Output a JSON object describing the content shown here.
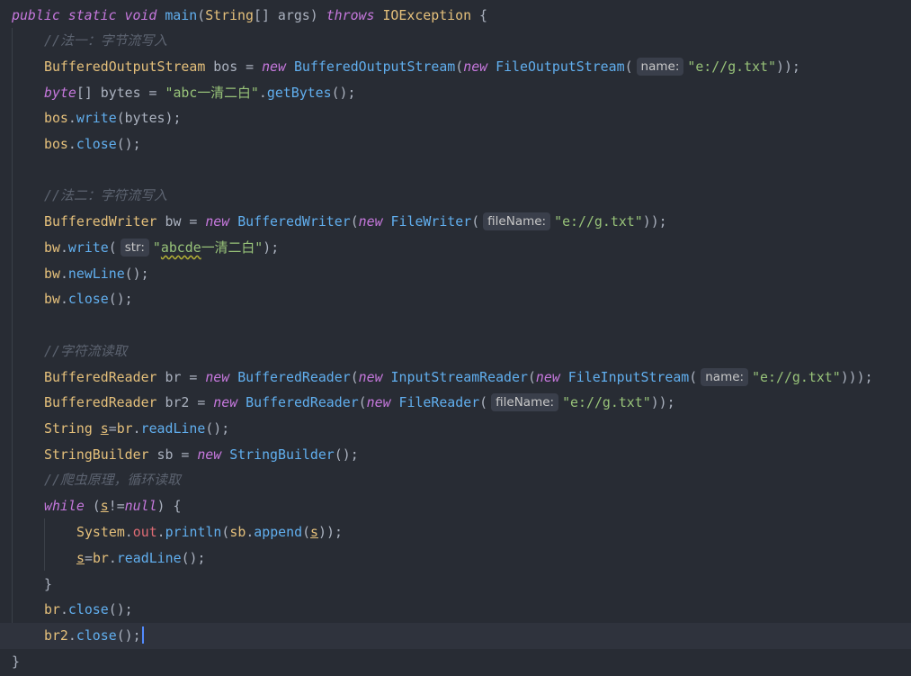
{
  "editor": {
    "language": "java",
    "lines": [
      [
        [
          "kw",
          "public static void "
        ],
        [
          "fn",
          "main"
        ],
        [
          "pu",
          "("
        ],
        [
          "ty",
          "String"
        ],
        [
          "pu",
          "[] "
        ],
        [
          "pu",
          "args) "
        ],
        [
          "kw",
          "throws "
        ],
        [
          "ty",
          "IOException "
        ],
        [
          "pu",
          "{"
        ]
      ],
      [
        [
          "cm",
          "//法一：字节流写入"
        ]
      ],
      [
        [
          "ty",
          "BufferedOutputStream "
        ],
        [
          "pu",
          "bos "
        ],
        [
          "pu",
          "= "
        ],
        [
          "kw",
          "new "
        ],
        [
          "fn",
          "BufferedOutputStream"
        ],
        [
          "pu",
          "("
        ],
        [
          "kw",
          "new "
        ],
        [
          "fn",
          "FileOutputStream"
        ],
        [
          "pu",
          "("
        ],
        [
          "hint",
          "name:"
        ],
        [
          "st",
          "\"e://g.txt\""
        ],
        [
          "pu",
          "));"
        ]
      ],
      [
        [
          "kw",
          "byte"
        ],
        [
          "pu",
          "[] bytes = "
        ],
        [
          "st",
          "\"abc一清二白\""
        ],
        [
          "pu",
          "."
        ],
        [
          "mf",
          "getBytes"
        ],
        [
          "pu",
          "();"
        ]
      ],
      [
        [
          "ty",
          "bos"
        ],
        [
          "pu",
          "."
        ],
        [
          "mf",
          "write"
        ],
        [
          "pu",
          "(bytes);"
        ]
      ],
      [
        [
          "ty",
          "bos"
        ],
        [
          "pu",
          "."
        ],
        [
          "mf",
          "close"
        ],
        [
          "pu",
          "();"
        ]
      ],
      [],
      [
        [
          "cm",
          "//法二：字符流写入"
        ]
      ],
      [
        [
          "ty",
          "BufferedWriter "
        ],
        [
          "pu",
          "bw = "
        ],
        [
          "kw",
          "new "
        ],
        [
          "fn",
          "BufferedWriter"
        ],
        [
          "pu",
          "("
        ],
        [
          "kw",
          "new "
        ],
        [
          "fn",
          "FileWriter"
        ],
        [
          "pu",
          "("
        ],
        [
          "hint",
          "fileName:"
        ],
        [
          "st",
          "\"e://g.txt\""
        ],
        [
          "pu",
          "));"
        ]
      ],
      [
        [
          "ty",
          "bw"
        ],
        [
          "pu",
          "."
        ],
        [
          "mf",
          "write"
        ],
        [
          "pu",
          "("
        ],
        [
          "hint",
          "str:"
        ],
        [
          "st",
          "\""
        ],
        [
          "sttypo",
          "abcde"
        ],
        [
          "st",
          "一清二白\""
        ],
        [
          "pu",
          ");"
        ]
      ],
      [
        [
          "ty",
          "bw"
        ],
        [
          "pu",
          "."
        ],
        [
          "mf",
          "newLine"
        ],
        [
          "pu",
          "();"
        ]
      ],
      [
        [
          "ty",
          "bw"
        ],
        [
          "pu",
          "."
        ],
        [
          "mf",
          "close"
        ],
        [
          "pu",
          "();"
        ]
      ],
      [],
      [
        [
          "cm",
          "//字符流读取"
        ]
      ],
      [
        [
          "ty",
          "BufferedReader "
        ],
        [
          "pu",
          "br = "
        ],
        [
          "kw",
          "new "
        ],
        [
          "fn",
          "BufferedReader"
        ],
        [
          "pu",
          "("
        ],
        [
          "kw",
          "new "
        ],
        [
          "fn",
          "InputStreamReader"
        ],
        [
          "pu",
          "("
        ],
        [
          "kw",
          "new "
        ],
        [
          "fn",
          "FileInputStream"
        ],
        [
          "pu",
          "("
        ],
        [
          "hint",
          "name:"
        ],
        [
          "st",
          "\"e://g.txt\""
        ],
        [
          "pu",
          ")));"
        ]
      ],
      [
        [
          "ty",
          "BufferedReader "
        ],
        [
          "pu",
          "br2 = "
        ],
        [
          "kw",
          "new "
        ],
        [
          "fn",
          "BufferedReader"
        ],
        [
          "pu",
          "("
        ],
        [
          "kw",
          "new "
        ],
        [
          "fn",
          "FileReader"
        ],
        [
          "pu",
          "("
        ],
        [
          "hint",
          "fileName:"
        ],
        [
          "st",
          "\"e://g.txt\""
        ],
        [
          "pu",
          "));"
        ]
      ],
      [
        [
          "ty",
          "String "
        ],
        [
          "varu",
          "s"
        ],
        [
          "pu",
          "="
        ],
        [
          "ty",
          "br"
        ],
        [
          "pu",
          "."
        ],
        [
          "mf",
          "readLine"
        ],
        [
          "pu",
          "();"
        ]
      ],
      [
        [
          "ty",
          "StringBuilder "
        ],
        [
          "pu",
          "sb = "
        ],
        [
          "kw",
          "new "
        ],
        [
          "fn",
          "StringBuilder"
        ],
        [
          "pu",
          "();"
        ]
      ],
      [
        [
          "cm",
          "//爬虫原理，循环读取"
        ]
      ],
      [
        [
          "kw",
          "while "
        ],
        [
          "pu",
          "("
        ],
        [
          "varu",
          "s"
        ],
        [
          "pu",
          "!="
        ],
        [
          "kw",
          "null"
        ],
        [
          "pu",
          ") {"
        ]
      ],
      [
        [
          "ty",
          "System"
        ],
        [
          "pu",
          "."
        ],
        [
          "lv",
          "out"
        ],
        [
          "pu",
          "."
        ],
        [
          "mf",
          "println"
        ],
        [
          "pu",
          "("
        ],
        [
          "ty",
          "sb"
        ],
        [
          "pu",
          "."
        ],
        [
          "mf",
          "append"
        ],
        [
          "pu",
          "("
        ],
        [
          "varu",
          "s"
        ],
        [
          "pu",
          "));"
        ]
      ],
      [
        [
          "varu",
          "s"
        ],
        [
          "pu",
          "="
        ],
        [
          "ty",
          "br"
        ],
        [
          "pu",
          "."
        ],
        [
          "mf",
          "readLine"
        ],
        [
          "pu",
          "();"
        ]
      ],
      [
        [
          "pu",
          "}"
        ]
      ],
      [
        [
          "ty",
          "br"
        ],
        [
          "pu",
          "."
        ],
        [
          "mf",
          "close"
        ],
        [
          "pu",
          "();"
        ]
      ],
      [
        [
          "ty",
          "br2"
        ],
        [
          "pu",
          "."
        ],
        [
          "mf",
          "close"
        ],
        [
          "pu",
          "();"
        ],
        [
          "caret",
          ""
        ]
      ],
      [
        [
          "pu",
          "}"
        ]
      ]
    ]
  }
}
